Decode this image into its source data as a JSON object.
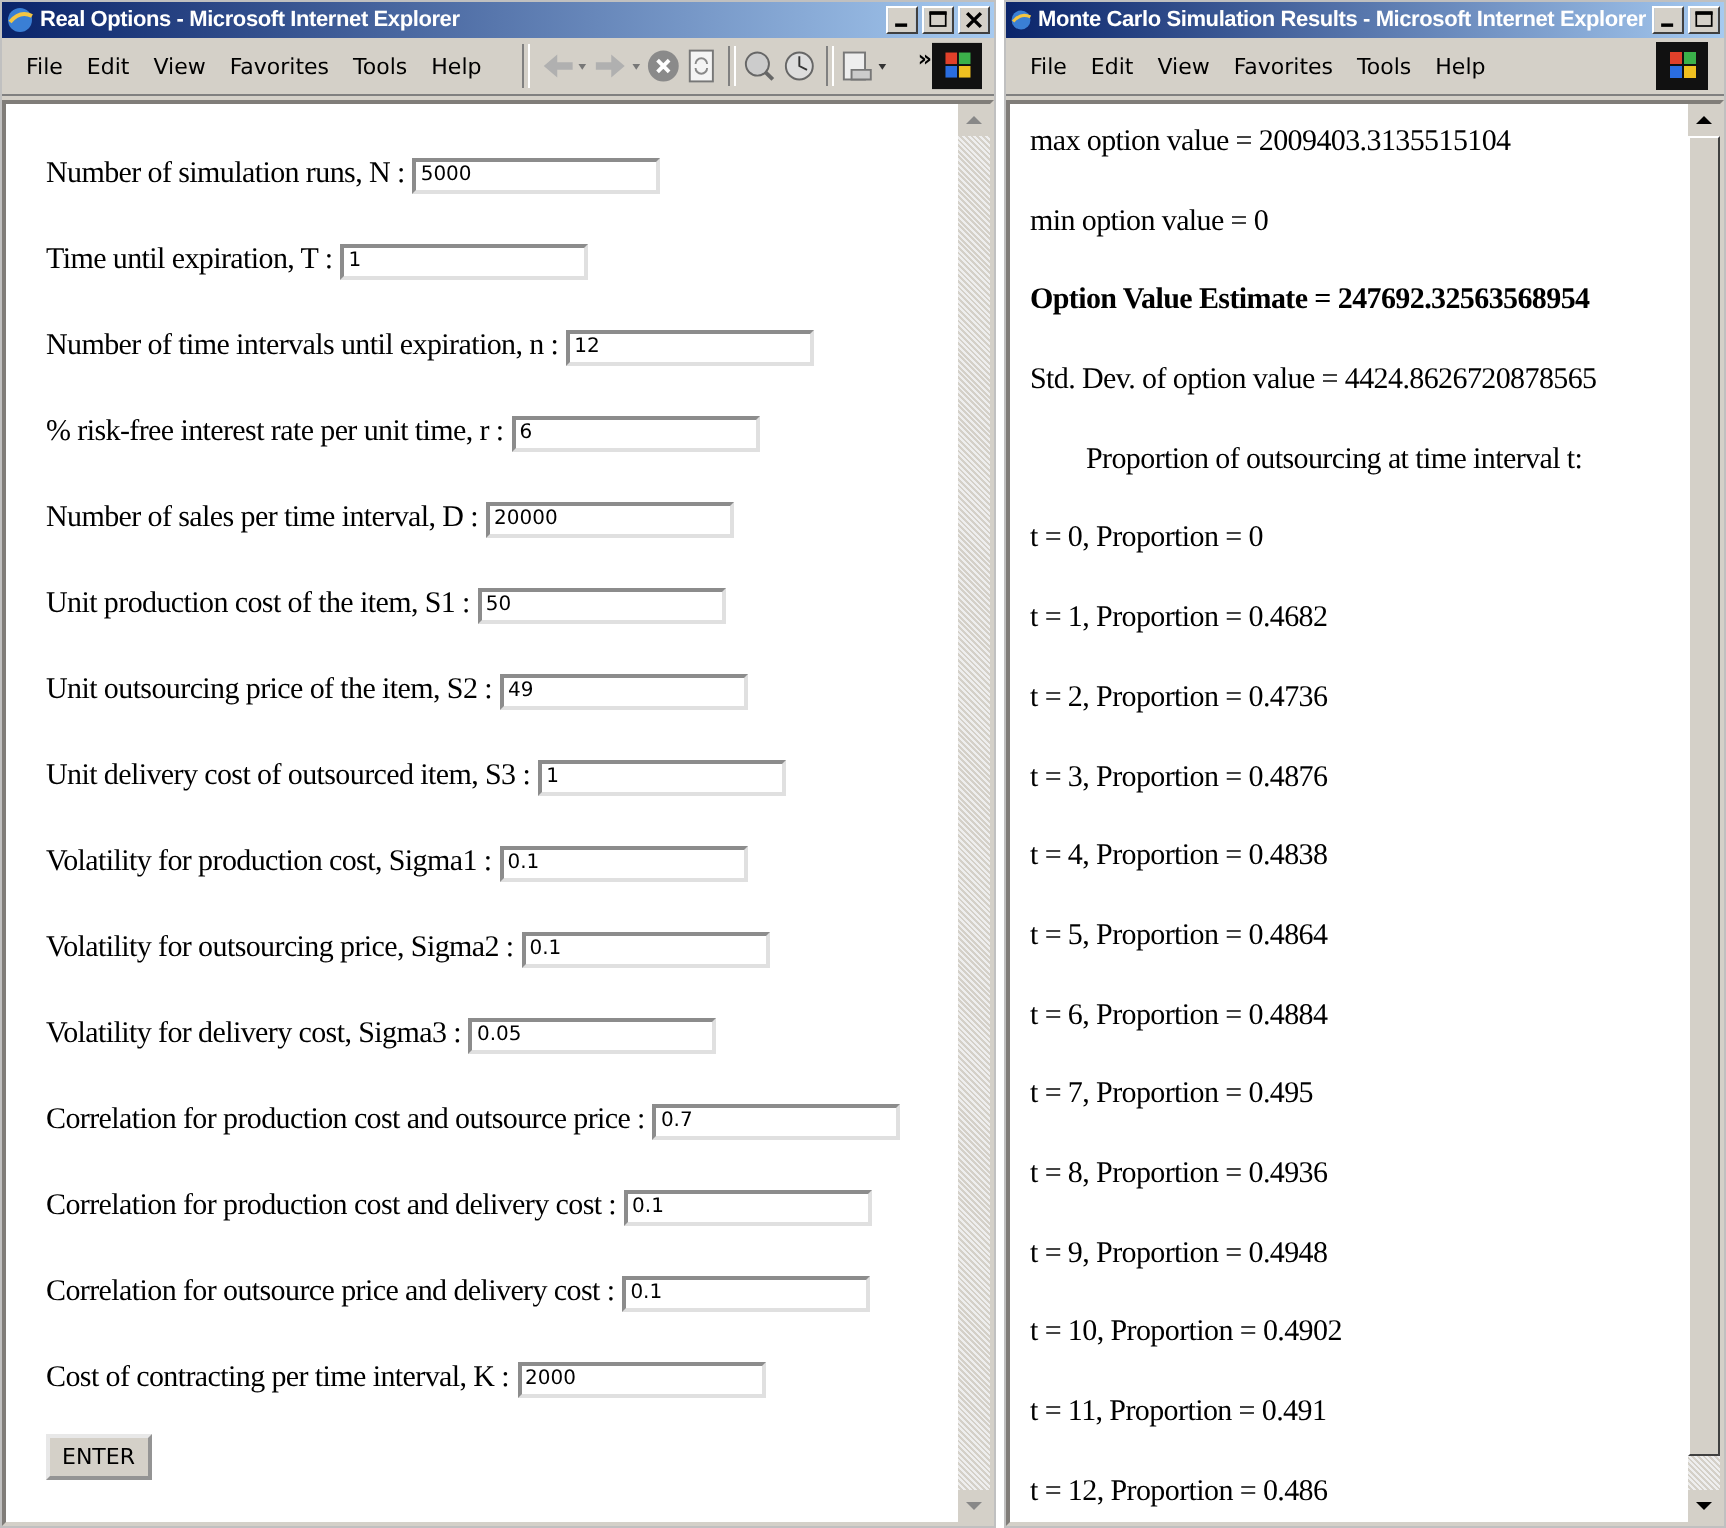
{
  "left_window": {
    "title": "Real Options - Microsoft Internet Explorer",
    "menu": [
      "File",
      "Edit",
      "View",
      "Favorites",
      "Tools",
      "Help"
    ],
    "toolbar_overflow": "»",
    "form": [
      {
        "label": "Number of simulation runs, N :",
        "value": "5000"
      },
      {
        "label": "Time until expiration, T :",
        "value": "1"
      },
      {
        "label": "Number of time intervals until expiration, n :",
        "value": "12"
      },
      {
        "label": "% risk-free interest rate per unit time, r :",
        "value": "6"
      },
      {
        "label": "Number of sales per time interval, D :",
        "value": "20000"
      },
      {
        "label": "Unit production cost of the item, S1 :",
        "value": "50"
      },
      {
        "label": "Unit outsourcing price of the item, S2 :",
        "value": "49"
      },
      {
        "label": "Unit delivery cost of outsourced item, S3 :",
        "value": "1"
      },
      {
        "label": "Volatility for production cost, Sigma1 :",
        "value": "0.1"
      },
      {
        "label": "Volatility for outsourcing price, Sigma2 :",
        "value": "0.1"
      },
      {
        "label": "Volatility for delivery cost, Sigma3 :",
        "value": "0.05"
      },
      {
        "label": "Correlation for production cost and outsource price :",
        "value": "0.7"
      },
      {
        "label": "Correlation for production cost and delivery cost :",
        "value": "0.1"
      },
      {
        "label": "Correlation for outsource price and delivery cost :",
        "value": "0.1"
      },
      {
        "label": "Cost of contracting per time interval, K :",
        "value": "2000"
      }
    ],
    "submit_button": "ENTER"
  },
  "right_window": {
    "title": "Monte Carlo Simulation Results - Microsoft Internet Explorer",
    "menu": [
      "File",
      "Edit",
      "View",
      "Favorites",
      "Tools",
      "Help"
    ],
    "lines": [
      {
        "kind": "plain",
        "text": "max option value = 2009403.3135515104"
      },
      {
        "kind": "plain",
        "text": "min option value = 0"
      },
      {
        "kind": "bold",
        "text": "Option Value Estimate = 247692.32563568954"
      },
      {
        "kind": "plain",
        "text": "Std. Dev. of option value = 4424.8626720878565"
      },
      {
        "kind": "heading",
        "text": "Proportion of outsourcing at time interval t:"
      },
      {
        "kind": "plain",
        "text": "t = 0, Proportion = 0"
      },
      {
        "kind": "plain",
        "text": "t = 1, Proportion = 0.4682"
      },
      {
        "kind": "plain",
        "text": "t = 2, Proportion = 0.4736"
      },
      {
        "kind": "plain",
        "text": "t = 3, Proportion = 0.4876"
      },
      {
        "kind": "plain",
        "text": "t = 4, Proportion = 0.4838"
      },
      {
        "kind": "plain",
        "text": "t = 5, Proportion = 0.4864"
      },
      {
        "kind": "plain",
        "text": "t = 6, Proportion = 0.4884"
      },
      {
        "kind": "plain",
        "text": "t = 7, Proportion = 0.495"
      },
      {
        "kind": "plain",
        "text": "t = 8, Proportion = 0.4936"
      },
      {
        "kind": "plain",
        "text": "t = 9, Proportion = 0.4948"
      },
      {
        "kind": "plain",
        "text": "t = 10, Proportion = 0.4902"
      },
      {
        "kind": "plain",
        "text": "t = 11, Proportion = 0.491"
      },
      {
        "kind": "plain",
        "text": "t = 12, Proportion = 0.486"
      }
    ]
  }
}
